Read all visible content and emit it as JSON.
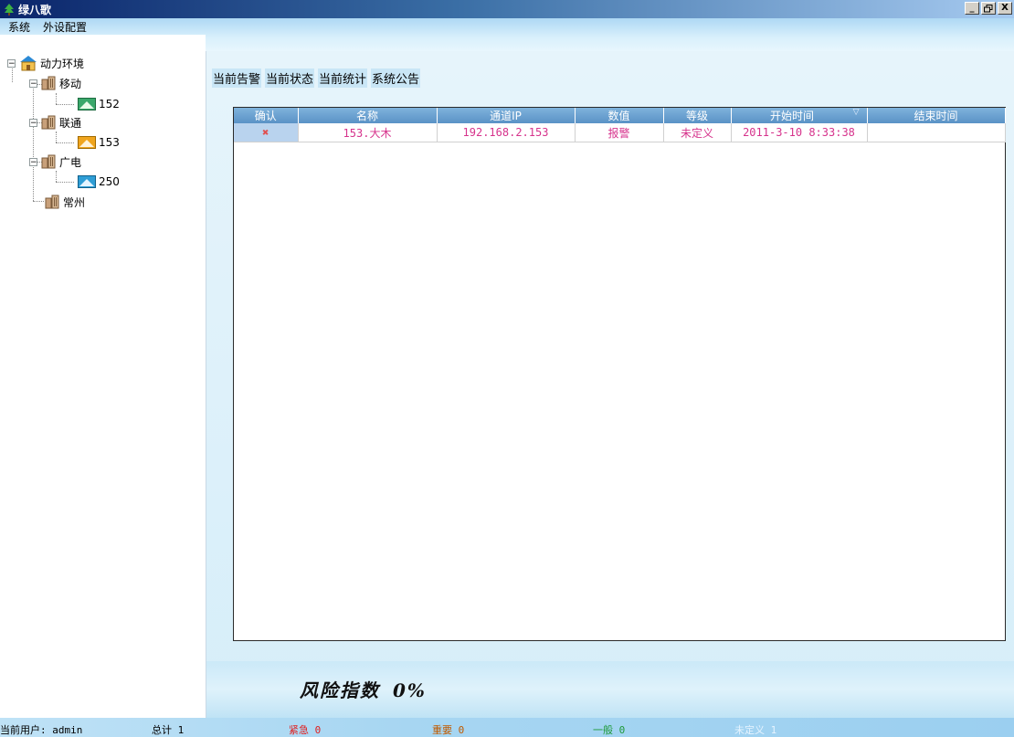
{
  "window": {
    "title": "绿八歌",
    "min_label": "_",
    "restore_label": "🗗",
    "close_label": "X"
  },
  "menu": {
    "items": [
      "系统",
      "外设配置"
    ]
  },
  "tree": {
    "root": "动力环境",
    "groups": [
      {
        "label": "移动",
        "device": "152",
        "device_color": "#3aa86b"
      },
      {
        "label": "联通",
        "device": "153",
        "device_color": "#f0a51e"
      },
      {
        "label": "广电",
        "device": "250",
        "device_color": "#2f9ed6"
      }
    ],
    "leaf": "常州"
  },
  "tabs": [
    "当前告警",
    "当前状态",
    "当前统计",
    "系统公告"
  ],
  "table": {
    "columns": [
      "确认",
      "名称",
      "通道IP",
      "数值",
      "等级",
      "开始时间",
      "结束时间"
    ],
    "rows": [
      {
        "confirm": "✖",
        "name": "153.大木",
        "ip": "192.168.2.153",
        "value": "报警",
        "level": "未定义",
        "start": "2011-3-10 8:33:38",
        "end": ""
      }
    ]
  },
  "risk": {
    "label": "风险指数",
    "value": "0%"
  },
  "status": {
    "user": "当前用户: admin",
    "total": "总计 1",
    "urgent": "紧急 0",
    "important": "重要 0",
    "normal": "一般 0",
    "undefined": "未定义 1",
    "colors": {
      "urgent": "#e02020",
      "important": "#c05a00",
      "normal": "#1f9a3a",
      "undefined": "#e6f4ff"
    }
  }
}
